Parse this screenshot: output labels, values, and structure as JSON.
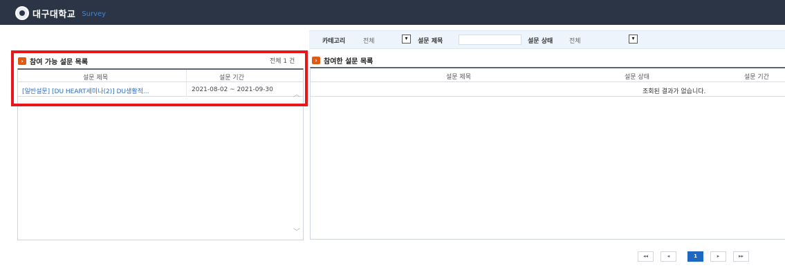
{
  "header": {
    "logo_text": "대구대학교",
    "logo_sub": "Survey"
  },
  "filter": {
    "category_label": "카테고리",
    "category_value": "전체",
    "title_label": "설문 제목",
    "title_value": "",
    "status_label": "설문 상태",
    "status_value": "전체"
  },
  "available": {
    "title": "참여 가능 설문 목록",
    "count": "전체 1 건",
    "columns": [
      "설문 제목",
      "설문 기간"
    ],
    "rows": [
      {
        "title": "[일반설문] [DU HEART세미나(2)] DU생활적...",
        "period": "2021-08-02 ~ 2021-09-30"
      }
    ]
  },
  "participated": {
    "title": "참여한 설문 목록",
    "columns": [
      "설문 제목",
      "설문 상태",
      "설문 기간"
    ],
    "empty_message": "조회된 결과가 없습니다."
  },
  "pagination": {
    "first": "◂◂",
    "prev": "◂",
    "current": "1",
    "next": "▸",
    "last": "▸▸"
  },
  "colors": {
    "topbar": "#2c3546",
    "accent": "#1f68c0",
    "highlight": "#e8151b",
    "bullet": "#e05a14"
  }
}
